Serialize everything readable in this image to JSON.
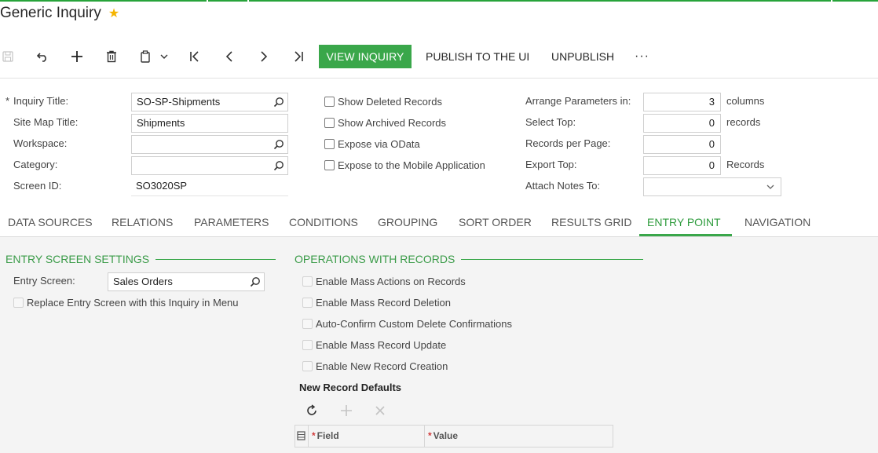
{
  "header": {
    "title": "Generic Inquiry",
    "favorite_icon": "star-icon"
  },
  "toolbar": {
    "icons": [
      "save-icon",
      "undo-icon",
      "add-icon",
      "delete-icon",
      "copy-paste-icon",
      "first-record-icon",
      "previous-record-icon",
      "next-record-icon",
      "last-record-icon"
    ],
    "view_inquiry": "VIEW INQUIRY",
    "publish": "PUBLISH TO THE UI",
    "unpublish": "UNPUBLISH",
    "more": "···"
  },
  "form": {
    "inquiry_title_label": "Inquiry Title:",
    "inquiry_title_value": "SO-SP-Shipments",
    "site_map_title_label": "Site Map Title:",
    "site_map_title_value": "Shipments",
    "workspace_label": "Workspace:",
    "workspace_value": "",
    "category_label": "Category:",
    "category_value": "",
    "screen_id_label": "Screen ID:",
    "screen_id_value": "SO3020SP",
    "show_deleted": "Show Deleted Records",
    "show_archived": "Show Archived Records",
    "expose_odata": "Expose via OData",
    "expose_mobile": "Expose to the Mobile Application",
    "arrange_label": "Arrange Parameters in:",
    "arrange_value": "3",
    "arrange_unit": "columns",
    "select_top_label": "Select Top:",
    "select_top_value": "0",
    "select_top_unit": "records",
    "records_per_page_label": "Records per Page:",
    "records_per_page_value": "0",
    "export_top_label": "Export Top:",
    "export_top_value": "0",
    "export_top_unit": "Records",
    "attach_notes_label": "Attach Notes To:",
    "attach_notes_value": ""
  },
  "tabs": [
    {
      "label": "DATA SOURCES"
    },
    {
      "label": "RELATIONS"
    },
    {
      "label": "PARAMETERS"
    },
    {
      "label": "CONDITIONS"
    },
    {
      "label": "GROUPING"
    },
    {
      "label": "SORT ORDER"
    },
    {
      "label": "RESULTS GRID"
    },
    {
      "label": "ENTRY POINT"
    },
    {
      "label": "NAVIGATION"
    }
  ],
  "active_tab": "ENTRY POINT",
  "entry_settings": {
    "title": "ENTRY SCREEN SETTINGS",
    "entry_screen_label": "Entry Screen:",
    "entry_screen_value": "Sales Orders",
    "replace_label": "Replace Entry Screen with this Inquiry in Menu"
  },
  "operations": {
    "title": "OPERATIONS WITH RECORDS",
    "items": [
      "Enable Mass Actions on Records",
      "Enable Mass Record Deletion",
      "Auto-Confirm Custom Delete Confirmations",
      "Enable Mass Record Update",
      "Enable New Record Creation"
    ]
  },
  "defaults": {
    "title": "New Record Defaults",
    "tools": [
      "refresh-icon",
      "add-icon",
      "delete-icon"
    ],
    "columns": [
      "Field",
      "Value"
    ],
    "required_mark": "*"
  },
  "colors": {
    "accent": "#3aa74a",
    "accent_text": "#2f9c3e",
    "star": "#f5b400"
  }
}
